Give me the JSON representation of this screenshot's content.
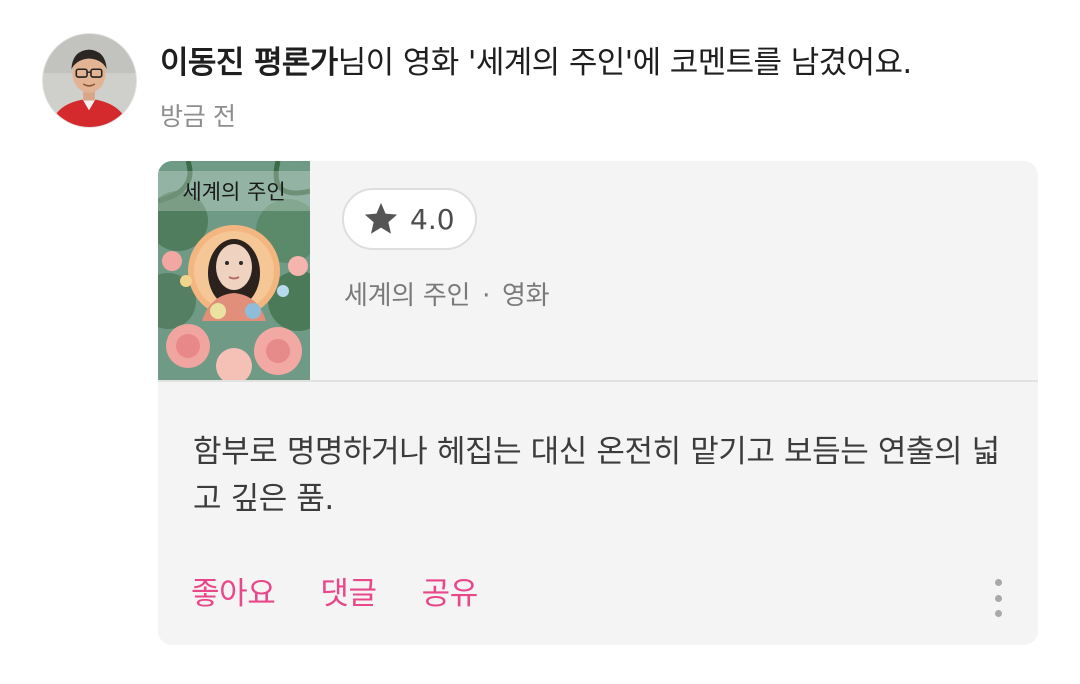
{
  "activity": {
    "author_name": "이동진 평론가",
    "action_text": "님이 영화 '세계의 주인'에 코멘트를 남겼어요.",
    "timestamp": "방금 전"
  },
  "card": {
    "poster_title_text": "세계의 주인",
    "rating_icon": "star-icon",
    "rating": "4.0",
    "movie_title": "세계의 주인",
    "meta_separator": "·",
    "category": "영화",
    "comment": "함부로 명명하거나 헤집는 대신 온전히 맡기고 보듬는 연출의 넓고 깊은 품."
  },
  "actions": {
    "like_label": "좋아요",
    "comment_label": "댓글",
    "share_label": "공유",
    "more_icon": "more-vertical-icon"
  },
  "colors": {
    "accent": "#e8488a",
    "card_background": "#f4f4f4",
    "muted_text": "#8e8e8e"
  }
}
